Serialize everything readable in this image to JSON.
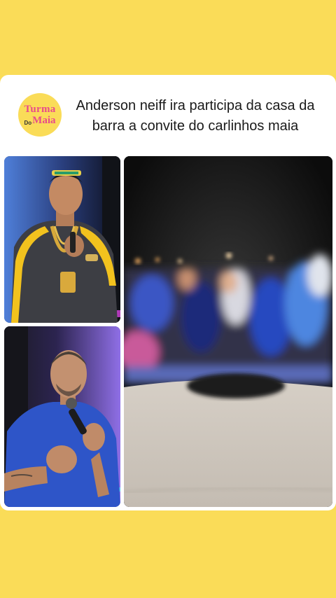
{
  "brand": {
    "logo_line1": "Turma",
    "logo_line2": "Do",
    "logo_line3": "Maia"
  },
  "post": {
    "headline": "Anderson neiff ira participa da casa da barra a convite do carlinhos maia"
  },
  "colors": {
    "background": "#FADC58",
    "card": "#FFFFFF",
    "logo_pink": "#E84B8A"
  }
}
